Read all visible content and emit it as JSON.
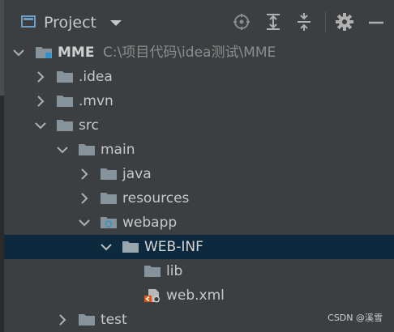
{
  "toolbar": {
    "title": "Project",
    "buttons": [
      "locate-icon",
      "expand-all-icon",
      "collapse-all-icon",
      "gear-icon",
      "minimize-icon"
    ]
  },
  "tree": {
    "root": {
      "name": "MME",
      "path": "C:\\项目代码\\idea测试\\MME",
      "expanded": true
    },
    "items": [
      {
        "label": "MME",
        "expanded": true
      },
      {
        "label": ".idea",
        "expanded": false
      },
      {
        "label": ".mvn",
        "expanded": false
      },
      {
        "label": "src",
        "expanded": true
      },
      {
        "label": "main",
        "expanded": true
      },
      {
        "label": "java",
        "expanded": false
      },
      {
        "label": "resources",
        "expanded": false
      },
      {
        "label": "webapp",
        "expanded": true
      },
      {
        "label": "WEB-INF",
        "expanded": true,
        "selected": true
      },
      {
        "label": "lib"
      },
      {
        "label": "web.xml"
      },
      {
        "label": "test",
        "expanded": false
      }
    ]
  },
  "watermark": "CSDN @溪雪",
  "colors": {
    "background": "#3c3f41",
    "selection": "#0d293e",
    "folder": "#87939a",
    "text": "#c8c8c8",
    "path_text": "#8c8c8c",
    "project_accent": "#6e9cc4"
  }
}
